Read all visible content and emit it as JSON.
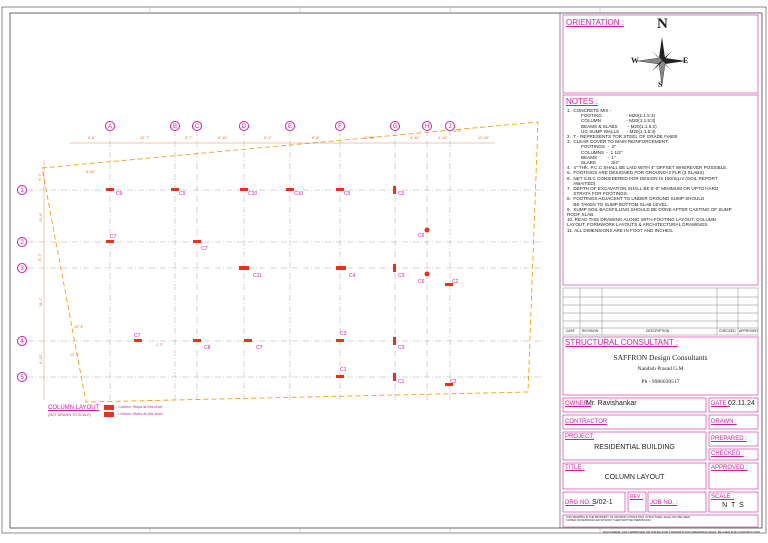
{
  "orientation": {
    "title": "ORIENTATION :",
    "north": "N",
    "south": "S",
    "east": "E",
    "west": "W"
  },
  "notes": {
    "title": "NOTES :",
    "lines": [
      "1.  CONCRETE MIX -",
      "           FOOTING                   - M20(1:1.5:3)",
      "           COLUMN                    - M20(1:1.5:3)",
      "           BEAMS & SLABS        - M20(1:1.5:3)",
      "           UG SUMP WALLS      - M20(1:1.5:3)",
      "2.  T - REPRESENTS TOR STEEL OF GRADE Fe500",
      "3.  CLEAR COVER TO MAIN REINFORCEMENT:",
      "           FOOTINGS  -  2\"",
      "           COLUMNS  -  1 1/2\"",
      "           BEAMS        -  1\"",
      "           SLABS         -  3/4\"",
      "4.  4\" THK. P.C.C SHALL BE LAID WITH 4\" OFFSET WHEREVER POSSIBLE.",
      "5.  FOOTINGS ARE DESIGNED FOR GROUND+2 FLR (3 SLABS)",
      "6.  NET S.B.C CONSIDERED FOR DESIGN IS 160/Sq.m (SOIL REPORT",
      "     AWAITED).",
      "7.  DEPTH OF EXCAVATION SHALL BE 5'-0\" MINIMUM OR UPTO HARD",
      "     STRATA FOR FOOTINGS.",
      "8.  FOOTINGS ADJACENT TO UNDER GROUND SUMP SHOULD",
      "     BE TAKEN TO SUMP BOTTOM SLAB LEVEL.",
      "9.  SUMP SOIL BACKFILLING SHOULD BE DONE AFTER CASTING OF SUMP",
      "ROOF SLAB.",
      "10. READ THIS DRAWING ALONG WITH FOOTING LAYOUT, COLUMN",
      "LAYOUT, FORMWORK LAYOUTS & ARCHITECTURAL DRAWINGS.",
      "11. ALL DIMENSIONS ARE IN FOOT AND INCHES."
    ]
  },
  "revision_table": {
    "headers": [
      "DATE",
      "REVISION",
      "DESCRIPTION",
      "CHECKED",
      "APPROVED"
    ]
  },
  "consultant": {
    "heading": "STRUCTURAL CONSULTANT :",
    "firm": "SAFFRON Design Consultants",
    "person": "Nandish Prasad G.M",
    "phone": "Ph - 9986039517"
  },
  "title_block": {
    "owner_label": "OWNER :",
    "owner": "Mr. Ravishankar",
    "date_label": "DATE :",
    "date": "02.11.24",
    "contractor_label": "CONTRACTOR",
    "drawn_label": "DRAWN :",
    "project_label": "PROJECT:",
    "project": "RESIDENTIAL BUILDING",
    "prepared_label": "PREPARED :",
    "checked_label": "CHECKED :",
    "title_label": "TITLE :",
    "title": "COLUMN LAYOUT",
    "approved_label": "APPROVED :",
    "dwg_label": "DRG NO. :",
    "dwg": "S/02-1",
    "rev_label": "REV :",
    "job_label": "JOB NO. :",
    "scale_label": "SCALE :",
    "scale": "N T S",
    "footer": "THIS DRAWING IS THE PROPERTY OF SAFFRON CONSULTING, STRUCTURAL SHALL NOT BE USED, COPIED OR REPRODUCED WITHOUT THEIR WRITTEN PERMISSION.",
    "disclaimer": "DISCLAIMER: ONLY APPROVED OR ISSUED FOR CONSTRUCTION DRAWINGS SHALL BE USED FOR CONSTRUCTION"
  },
  "legend": {
    "title": "COLUMN LAYOUT",
    "scale_note": "(NOT DRAWN TO SCALE)",
    "item1": "- Column Stops at this level",
    "item2": "- Column Starts at this level"
  },
  "grid": {
    "cols": [
      "A",
      "B",
      "C",
      "D",
      "E",
      "F",
      "G",
      "H",
      "J"
    ],
    "rows": [
      "1",
      "2",
      "3",
      "4",
      "5"
    ],
    "top_dims": [
      "6'-6\"",
      "12'-7\"",
      "4'-7\"",
      "8'-10\"",
      "9'-1\"",
      "8'-8\"",
      "11'-90\"",
      "4'-90\"",
      "4'-10\"",
      "11'-10\""
    ],
    "side_dims": [
      "6'-7\"",
      "10'-6\"",
      "6'-7\"",
      "18'-1\"",
      "6'-10\""
    ]
  },
  "columns": [
    "C9",
    "C9",
    "C10",
    "C10",
    "C5",
    "C5",
    "C6",
    "C7",
    "C7",
    "C11",
    "C4",
    "C3",
    "C6",
    "C2",
    "C7",
    "C8",
    "C7",
    "C3",
    "C3",
    "C1",
    "C1",
    "C2"
  ],
  "plan_notes": [
    "5'-60\"",
    "10\" Φ",
    "12' 3\"",
    "1'-3\"",
    "6'-4\""
  ]
}
